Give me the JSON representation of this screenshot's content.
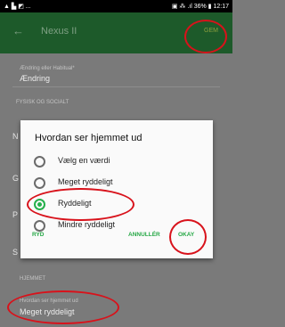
{
  "status": {
    "left": "▲ ▙ ◩ ...",
    "right": "▣ ⁂ .ıl 36% ▮ 12:17"
  },
  "appbar": {
    "title": "Nexus II",
    "back_icon": "arrow-left",
    "save_label": "GEM"
  },
  "form": {
    "change_label": "Ændring eller Habitual*",
    "change_value": "Ændring",
    "section_physical": "FYSISK OG SOCIALT",
    "hidden_values": [
      "N",
      "G",
      "P",
      "S"
    ],
    "section_home": "HJEMMET",
    "home_label": "Hvordan ser hjemmet ud",
    "home_value": "Meget ryddeligt"
  },
  "dialog": {
    "title": "Hvordan ser hjemmet ud",
    "options": [
      {
        "label": "Vælg en værdi",
        "selected": false
      },
      {
        "label": "Meget ryddeligt",
        "selected": false
      },
      {
        "label": "Ryddeligt",
        "selected": true
      },
      {
        "label": "Mindre ryddeligt",
        "selected": false
      }
    ],
    "clear_label": "RYD",
    "cancel_label": "ANNULLÉR",
    "ok_label": "OKAY"
  },
  "colors": {
    "accent": "#26a846",
    "appbar": "#1d5a2a",
    "annotation": "#d8121b"
  }
}
